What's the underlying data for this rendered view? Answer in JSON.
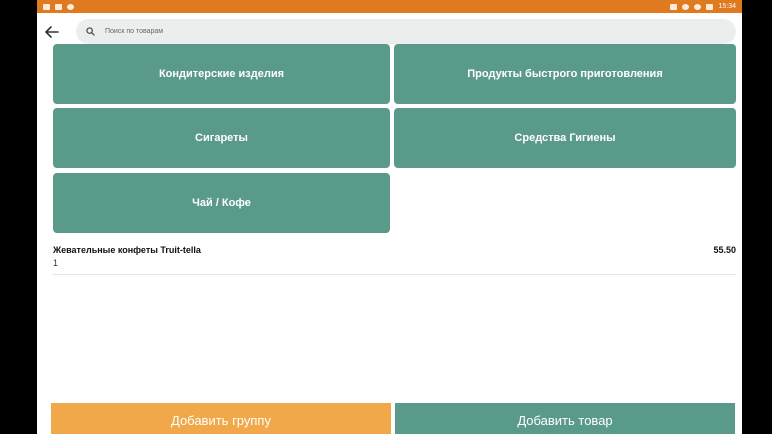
{
  "status_bar": {
    "time": "15:34"
  },
  "search": {
    "placeholder": "Поиск по товарам"
  },
  "categories": [
    {
      "label": "Кондитерские изделия"
    },
    {
      "label": "Продукты быстрого приготовления"
    },
    {
      "label": "Сигареты"
    },
    {
      "label": "Средства Гигиены"
    },
    {
      "label": "Чай / Кофе"
    }
  ],
  "items": [
    {
      "name": "Жевательные конфеты Truit-tella",
      "quantity": "1",
      "price": "55.50"
    }
  ],
  "actions": {
    "add_group_label": "Добавить группу",
    "add_product_label": "Добавить товар"
  },
  "colors": {
    "accent_teal": "#5a9a8a",
    "accent_orange": "#f0a84a",
    "status_bar": "#e07a1f"
  },
  "icons": {
    "back": "back-arrow-icon",
    "search": "search-icon"
  }
}
